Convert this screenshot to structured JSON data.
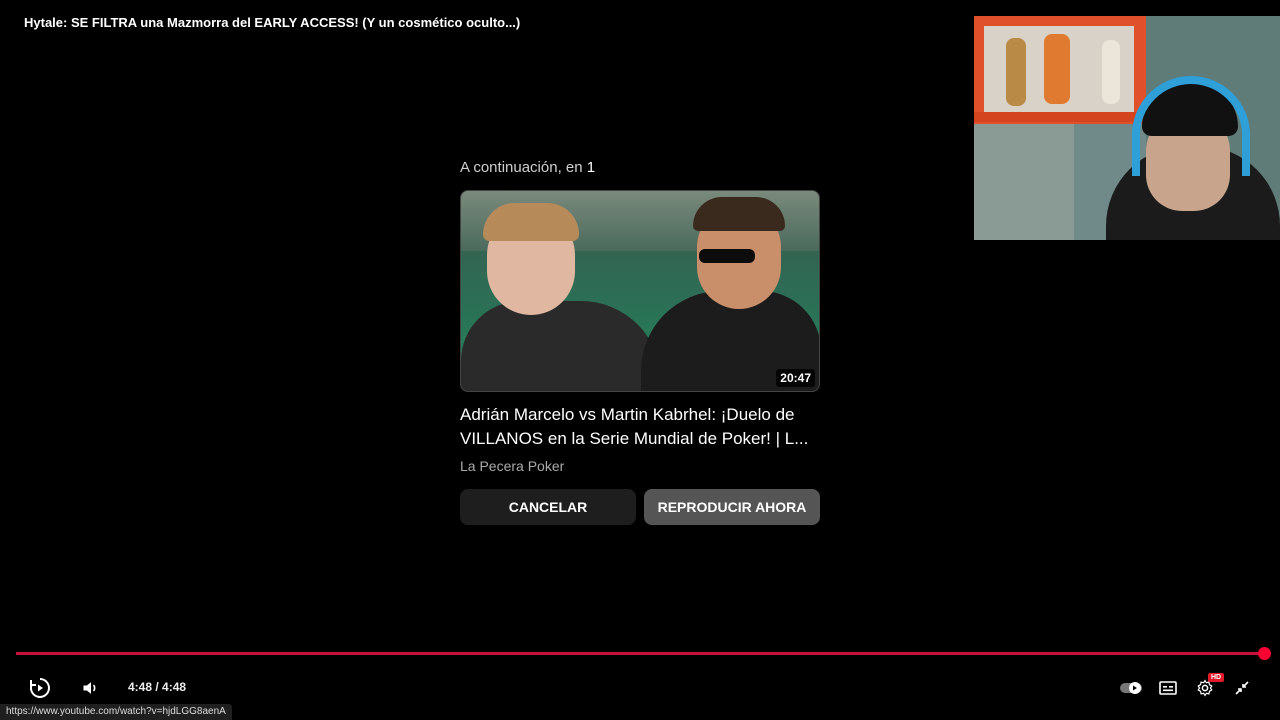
{
  "video": {
    "title": "Hytale: SE FILTRA una Mazmorra del EARLY ACCESS! (Y un cosmético oculto...)"
  },
  "up_next": {
    "label": "A continuación, en",
    "countdown": "1",
    "title": "Adrián Marcelo vs Martin Kabrhel: ¡Duelo de VILLANOS en la Serie Mundial de Poker! | L...",
    "channel": "La Pecera Poker",
    "duration": "20:47",
    "cancel_label": "CANCELAR",
    "play_now_label": "REPRODUCIR AHORA"
  },
  "player": {
    "time_display": "4:48 / 4:48",
    "progress_fraction": 1.0,
    "progress_color": "#ff0033",
    "hd_badge": "HD",
    "icons": {
      "replay": "replay-icon",
      "volume": "volume-icon",
      "autoplay": "autoplay-toggle-icon",
      "subtitles": "subtitles-icon",
      "settings": "gear-icon",
      "exit_fullscreen": "exit-fullscreen-icon"
    }
  },
  "status_bar": {
    "url": "https://www.youtube.com/watch?v=hjdLGG8aenA"
  }
}
